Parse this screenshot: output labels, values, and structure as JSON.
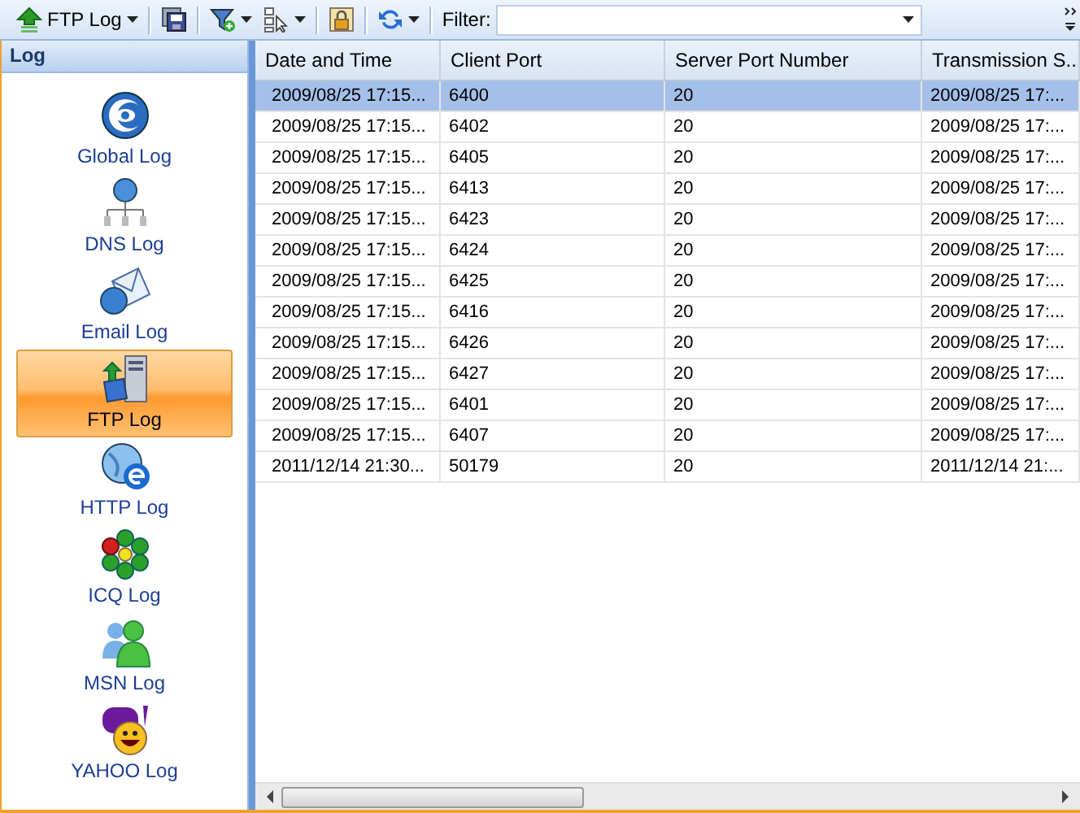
{
  "toolbar": {
    "log_menu": "FTP Log",
    "filter_label": "Filter:"
  },
  "sidebar": {
    "title": "Log",
    "items": [
      {
        "label": "Global Log",
        "kind": "global",
        "selected": false
      },
      {
        "label": "DNS Log",
        "kind": "dns",
        "selected": false
      },
      {
        "label": "Email Log",
        "kind": "email",
        "selected": false
      },
      {
        "label": "FTP Log",
        "kind": "ftp",
        "selected": true
      },
      {
        "label": "HTTP Log",
        "kind": "http",
        "selected": false
      },
      {
        "label": "ICQ Log",
        "kind": "icq",
        "selected": false
      },
      {
        "label": "MSN Log",
        "kind": "msn",
        "selected": false
      },
      {
        "label": "YAHOO Log",
        "kind": "yahoo",
        "selected": false
      }
    ]
  },
  "table": {
    "columns": [
      "Date and Time",
      "Client Port",
      "Server Port Number",
      "Transmission S.."
    ],
    "rows": [
      {
        "cells": [
          "2009/08/25 17:15...",
          "6400",
          "20",
          "2009/08/25 17:..."
        ],
        "selected": true
      },
      {
        "cells": [
          "2009/08/25 17:15...",
          "6402",
          "20",
          "2009/08/25 17:..."
        ],
        "selected": false
      },
      {
        "cells": [
          "2009/08/25 17:15...",
          "6405",
          "20",
          "2009/08/25 17:..."
        ],
        "selected": false
      },
      {
        "cells": [
          "2009/08/25 17:15...",
          "6413",
          "20",
          "2009/08/25 17:..."
        ],
        "selected": false
      },
      {
        "cells": [
          "2009/08/25 17:15...",
          "6423",
          "20",
          "2009/08/25 17:..."
        ],
        "selected": false
      },
      {
        "cells": [
          "2009/08/25 17:15...",
          "6424",
          "20",
          "2009/08/25 17:..."
        ],
        "selected": false
      },
      {
        "cells": [
          "2009/08/25 17:15...",
          "6425",
          "20",
          "2009/08/25 17:..."
        ],
        "selected": false
      },
      {
        "cells": [
          "2009/08/25 17:15...",
          "6416",
          "20",
          "2009/08/25 17:..."
        ],
        "selected": false
      },
      {
        "cells": [
          "2009/08/25 17:15...",
          "6426",
          "20",
          "2009/08/25 17:..."
        ],
        "selected": false
      },
      {
        "cells": [
          "2009/08/25 17:15...",
          "6427",
          "20",
          "2009/08/25 17:..."
        ],
        "selected": false
      },
      {
        "cells": [
          "2009/08/25 17:15...",
          "6401",
          "20",
          "2009/08/25 17:..."
        ],
        "selected": false
      },
      {
        "cells": [
          "2009/08/25 17:15...",
          "6407",
          "20",
          "2009/08/25 17:..."
        ],
        "selected": false
      },
      {
        "cells": [
          "2011/12/14 21:30...",
          "50179",
          "20",
          "2011/12/14 21:..."
        ],
        "selected": false
      }
    ]
  }
}
